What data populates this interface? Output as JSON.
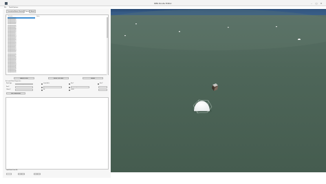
{
  "window": {
    "title": "RBS Route Editor",
    "app_icon": "app-icon",
    "minimize_glyph": "–",
    "maximize_glyph": "□",
    "close_glyph": "✕"
  },
  "menu": {
    "items": [
      "File",
      "Tools/Options"
    ]
  },
  "tabs": [
    {
      "label": "Centreline/Route (Sections)",
      "active": false
    },
    {
      "label": "Points",
      "active": true
    },
    {
      "label": "Blob Data",
      "active": false
    }
  ],
  "list": {
    "headers": [
      "Number",
      "Value"
    ],
    "rows": [
      "0000000000000000",
      "0000000000001",
      "0000000000002",
      "0000000000003",
      "0000000000004",
      "0000000000005",
      "0000000000006",
      "0000000000007",
      "0000000000008",
      "0000000000009",
      "0000000000010",
      "0000000000011",
      "0000000000012",
      "0000000000013",
      "0000000000014",
      "0000000000015",
      "0000000000016",
      "0000000000017",
      "0000000000018",
      "0000000000019",
      "0000000000020",
      "0000000000021",
      "0000000000022",
      "0000000000023",
      "0000000000024",
      "0000000000025",
      "0000000000026",
      "0000000000027",
      "0000000000028",
      "0000000000029",
      "0000000000030",
      "0000000000031",
      "0000000000032",
      "0000000000033",
      "0000000000034",
      "0000000000035",
      "0000000000036",
      "0000000000037",
      "0000000000038",
      "0000000000039"
    ]
  },
  "actions": {
    "add": "Add/Set Point",
    "delete": "Delete This Point",
    "update": "Update"
  },
  "properties": {
    "title": "Selected Point Properties",
    "labels": [
      "Point Type",
      "Pos X",
      "Pos Y",
      "Pos Z",
      "Name",
      "Dir",
      "Offset Z"
    ],
    "values": [
      "Attraction/Object",
      "0.00000",
      "0.00000",
      "Static/Object",
      "0.00000",
      "0.000",
      "Save",
      "Tour/Load/Import"
    ],
    "flag_label": "Leave As Is",
    "lower_label": "Tour Point Properties"
  },
  "status": {
    "label": "Load Route From File",
    "fields": [
      "0",
      "0",
      "0"
    ]
  },
  "viewport_colors": {
    "sky": "#3a5f8a",
    "ground": "#4d6658",
    "ground_dark": "#3f564a"
  }
}
